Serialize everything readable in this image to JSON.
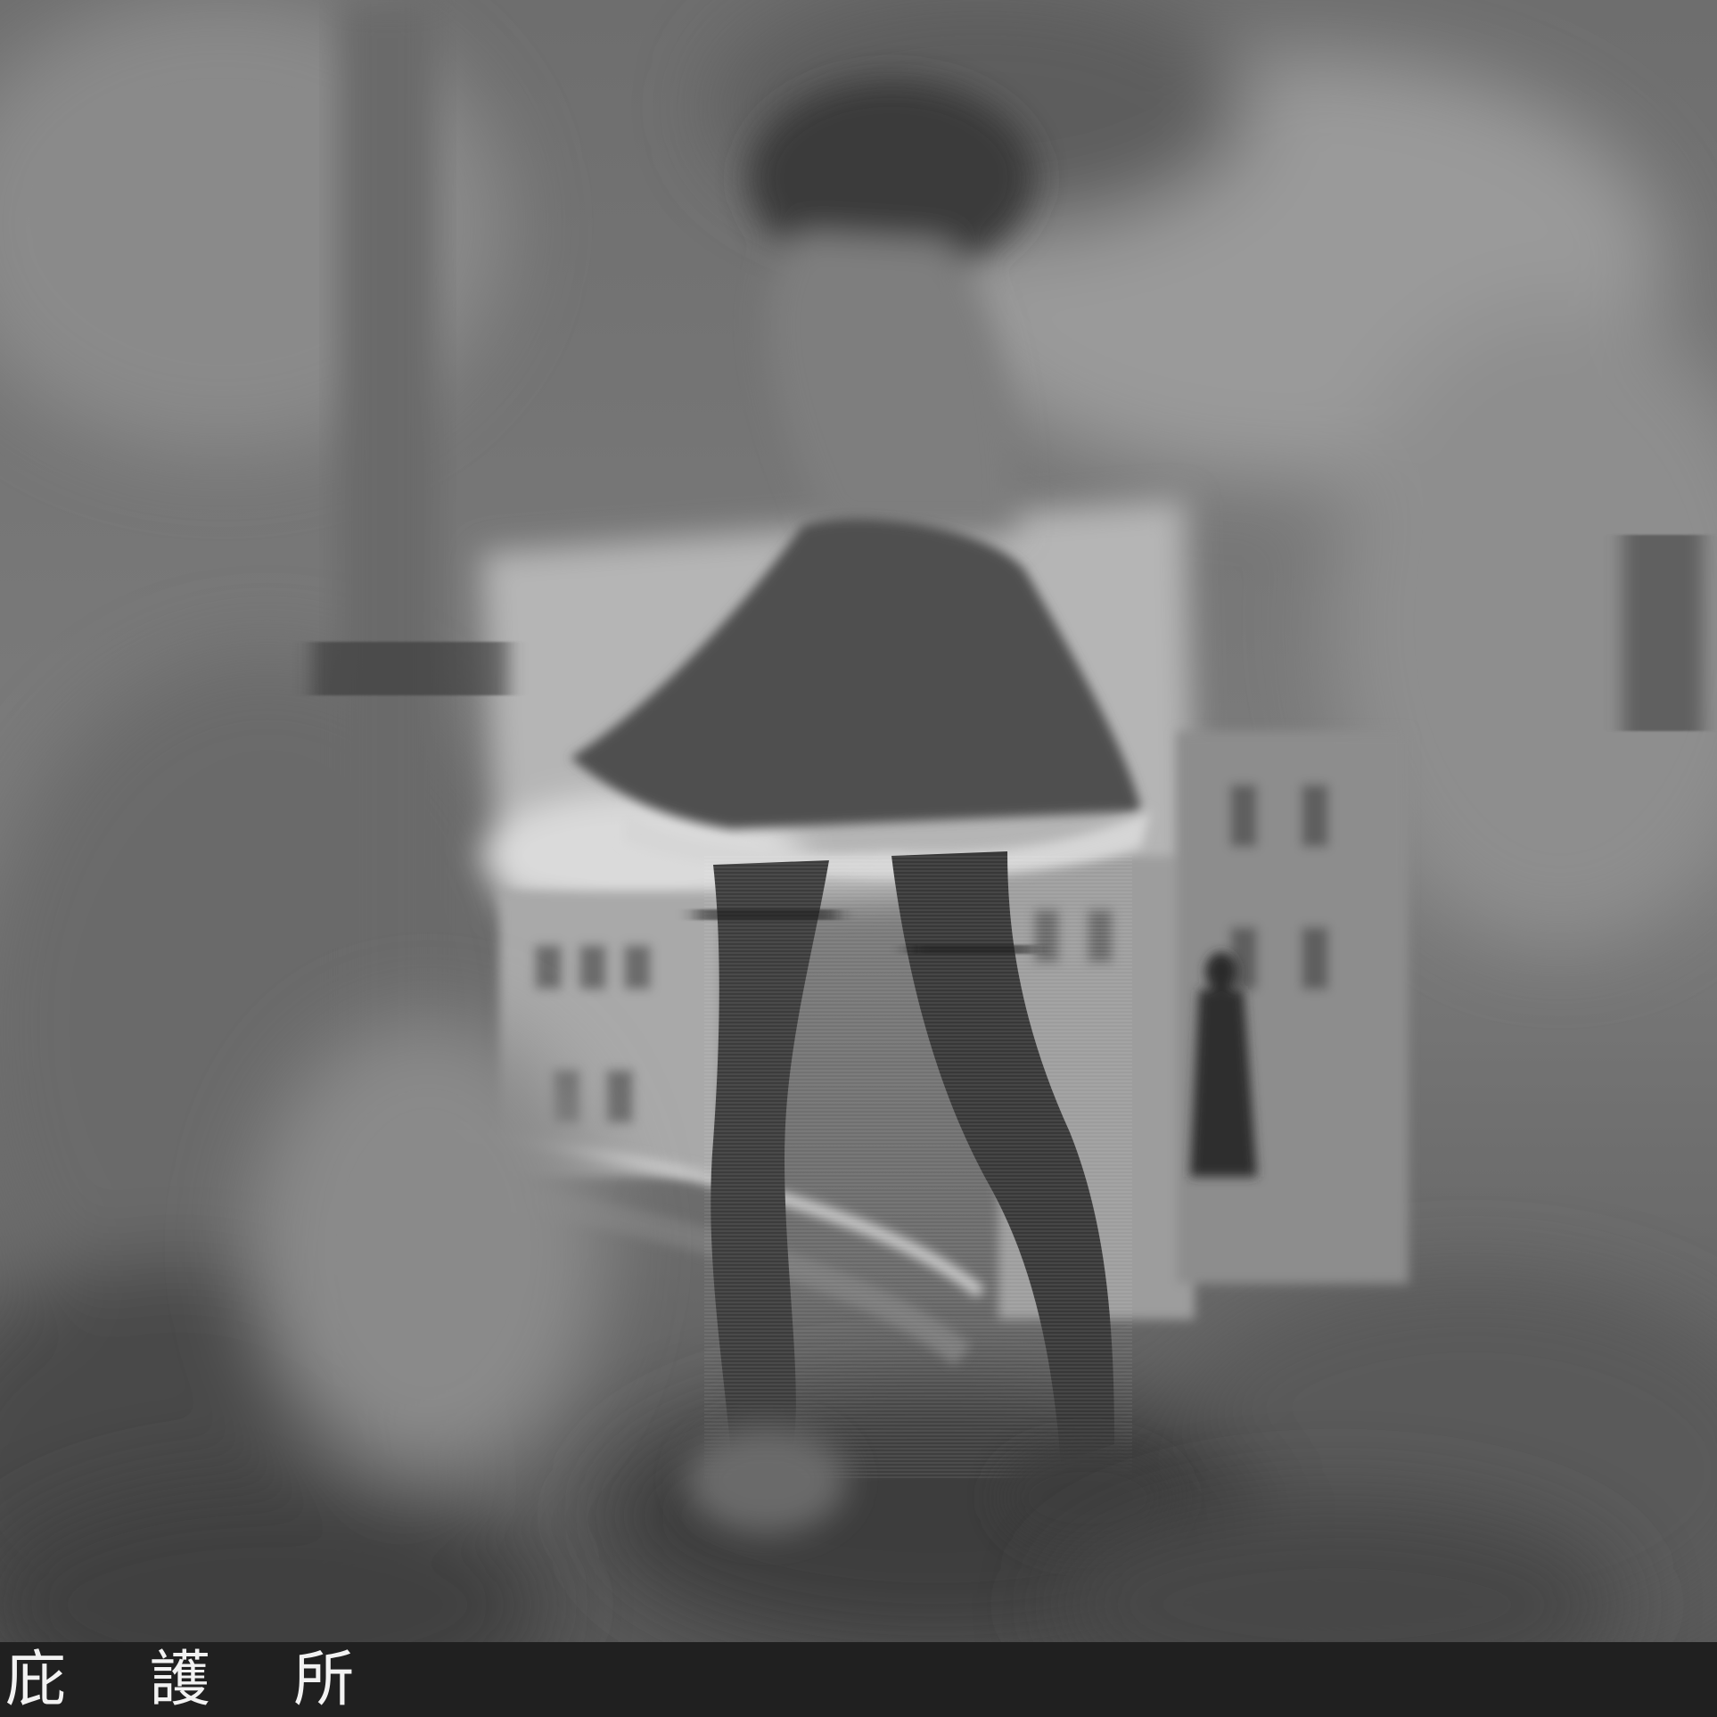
{
  "caption": {
    "title": "庇 護 所"
  },
  "colors": {
    "caption_bar": "#202020",
    "caption_text": "#f2f2f2"
  }
}
